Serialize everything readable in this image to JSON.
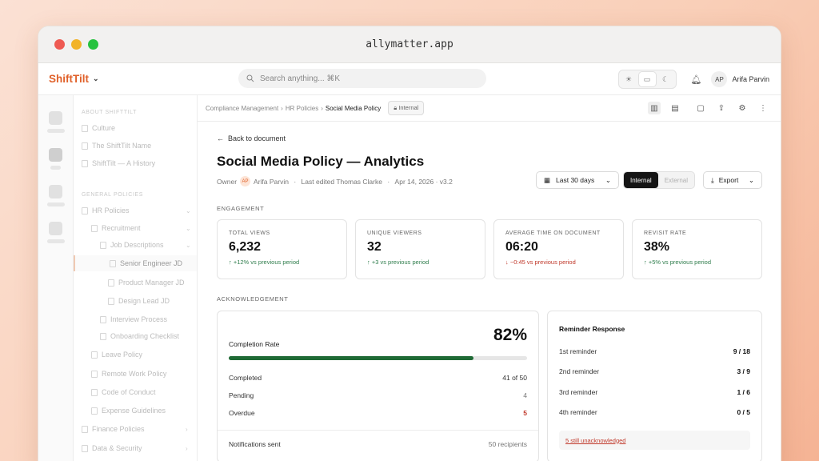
{
  "window": {
    "url": "allymatter.app"
  },
  "topbar": {
    "brand": "ShiftTilt",
    "search_placeholder": "Search anything... ⌘K",
    "user_initials": "AP",
    "user_name": "Arifa Parvin"
  },
  "sidebar": {
    "section_about": "ABOUT SHIFTTILT",
    "about_items": [
      "Culture",
      "The ShiftTilt Name",
      "ShiftTilt — A History"
    ],
    "section_general": "GENERAL POLICIES",
    "hr_policies": "HR Policies",
    "recruitment": "Recruitment",
    "job_descriptions": "Job Descriptions",
    "jd_items": [
      "Senior Engineer JD",
      "Product Manager JD",
      "Design Lead JD"
    ],
    "interview_process": "Interview Process",
    "onboarding_checklist": "Onboarding Checklist",
    "hr_items": [
      "Leave Policy",
      "Remote Work Policy",
      "Code of Conduct",
      "Expense Guidelines"
    ],
    "finance_policies": "Finance Policies",
    "data_security": "Data & Security"
  },
  "breadcrumb": {
    "items": [
      "Compliance Management",
      "HR Policies"
    ],
    "current": "Social Media Policy",
    "visibility": "Internal"
  },
  "page": {
    "back": "Back to document",
    "title": "Social Media Policy — Analytics",
    "owner_label": "Owner",
    "owner_initials": "AP",
    "owner_name": "Arifa Parvin",
    "last_edited": "Last edited Thomas Clarke",
    "date_version": "Apr 14, 2026 · v3.2",
    "range": "Last 30 days",
    "seg_internal": "Internal",
    "seg_external": "External",
    "export": "Export"
  },
  "engagement": {
    "label": "ENGAGEMENT",
    "cards": [
      {
        "title": "TOTAL VIEWS",
        "value": "6,232",
        "delta": "↑ +12% vs previous period",
        "trend": "up"
      },
      {
        "title": "UNIQUE VIEWERS",
        "value": "32",
        "delta": "↑ +3 vs previous period",
        "trend": "up"
      },
      {
        "title": "AVERAGE TIME ON DOCUMENT",
        "value": "06:20",
        "delta": "↓ −0:45 vs previous period",
        "trend": "down"
      },
      {
        "title": "REVISIT RATE",
        "value": "38%",
        "delta": "↑ +5% vs previous period",
        "trend": "up"
      }
    ]
  },
  "acknowledgement": {
    "label": "ACKNOWLEDGEMENT",
    "completion_label": "Completion Rate",
    "completion_value": "82%",
    "completion_fraction": 0.82,
    "completed_label": "Completed",
    "completed_value": "41 of 50",
    "pending_label": "Pending",
    "pending_value": "4",
    "overdue_label": "Overdue",
    "overdue_value": "5",
    "notifications_label": "Notifications sent",
    "notifications_value": "50 recipients"
  },
  "reminders": {
    "title": "Reminder Response",
    "rows": [
      {
        "label": "1st reminder",
        "value": "9 / 18"
      },
      {
        "label": "2nd reminder",
        "value": "3 / 9"
      },
      {
        "label": "3rd reminder",
        "value": "1 / 6"
      },
      {
        "label": "4th reminder",
        "value": "0 / 5"
      }
    ],
    "warning": "5 still unacknowledged"
  },
  "colors": {
    "brand": "#e0612a",
    "progress": "#1f6a35",
    "up": "#2f7d4c",
    "down": "#c0392b"
  }
}
